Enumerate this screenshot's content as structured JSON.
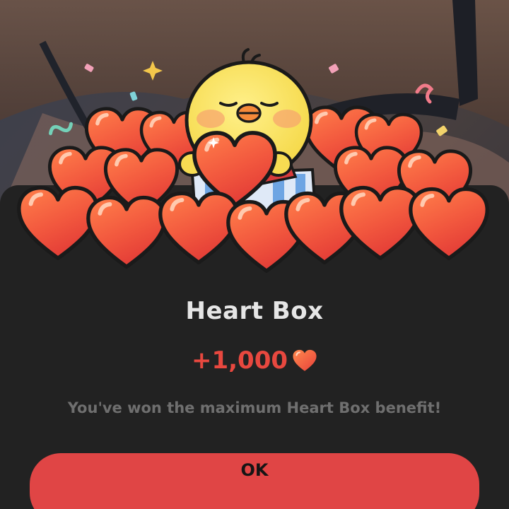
{
  "dialog": {
    "title": "Heart Box",
    "reward_amount": "+1,000",
    "message": "You've won the maximum Heart Box benefit!",
    "ok_label": "OK"
  },
  "icons": {
    "reward_icon": "heart-icon",
    "mascot": "yellow-chick-mascot"
  },
  "colors": {
    "accent": "#e04545",
    "amount": "#e8483f",
    "sheet_background": "#222222",
    "title": "#e6e6e6",
    "message": "#6f6f6f",
    "heart": "#f2583e"
  }
}
